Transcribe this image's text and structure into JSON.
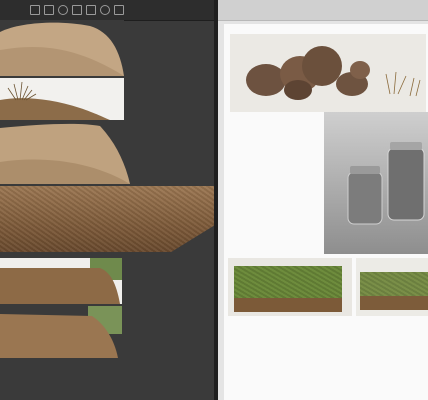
{
  "left_panel": {
    "toolbar_label": "",
    "tools": [
      "move-tool",
      "grid-tool",
      "pen-tool",
      "select-tool",
      "crop-tool",
      "search-tool",
      "layers-tool"
    ]
  },
  "right_panel": {
    "tabs": [
      "",
      "",
      "",
      ""
    ],
    "captions": {
      "rocks": [
        "",
        "",
        ""
      ],
      "jars": [
        ""
      ],
      "moss_left": [
        ""
      ],
      "moss_right": [
        ""
      ],
      "footer": [
        "",
        "",
        ""
      ]
    }
  },
  "colors": {
    "left_bg": "#3a3a3a",
    "right_bg": "#fafafa",
    "sand": "#b59a77",
    "soil": "#7e5b3a",
    "moss": "#5f7a33"
  }
}
